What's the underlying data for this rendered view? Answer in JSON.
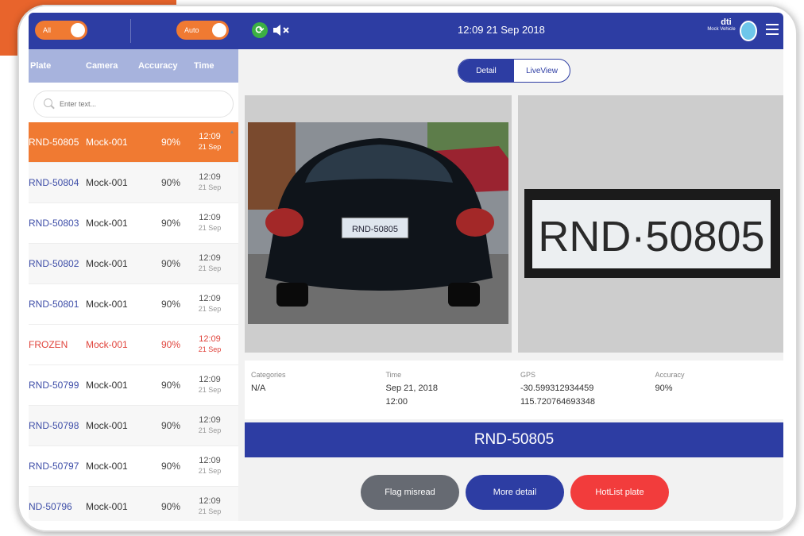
{
  "topbar": {
    "toggle_left_label": "All",
    "toggle_right_label": "Auto",
    "datetime": "12:09 21 Sep 2018",
    "user_short": "dti",
    "user_full": "Mock Vehicle",
    "refresh_icon": "refresh-icon",
    "mute_icon": "mute-icon",
    "menu_icon": "hamburger-menu-icon",
    "brand_color": "#2d3da3",
    "accent_color": "#f07a32"
  },
  "sidebar": {
    "columns": {
      "plate": "Plate",
      "camera": "Camera",
      "accuracy": "Accuracy",
      "time": "Time"
    },
    "search": {
      "placeholder": "Enter text..."
    },
    "rows": [
      {
        "plate": "RND-50805",
        "camera": "Mock-001",
        "accuracy": "90%",
        "time": "12:09",
        "date": "21 Sep",
        "state": "selected"
      },
      {
        "plate": "RND-50804",
        "camera": "Mock-001",
        "accuracy": "90%",
        "time": "12:09",
        "date": "21 Sep",
        "state": "normal"
      },
      {
        "plate": "RND-50803",
        "camera": "Mock-001",
        "accuracy": "90%",
        "time": "12:09",
        "date": "21 Sep",
        "state": "normal"
      },
      {
        "plate": "RND-50802",
        "camera": "Mock-001",
        "accuracy": "90%",
        "time": "12:09",
        "date": "21 Sep",
        "state": "normal"
      },
      {
        "plate": "RND-50801",
        "camera": "Mock-001",
        "accuracy": "90%",
        "time": "12:09",
        "date": "21 Sep",
        "state": "normal"
      },
      {
        "plate": "FROZEN",
        "camera": "Mock-001",
        "accuracy": "90%",
        "time": "12:09",
        "date": "21 Sep",
        "state": "frozen"
      },
      {
        "plate": "RND-50799",
        "camera": "Mock-001",
        "accuracy": "90%",
        "time": "12:09",
        "date": "21 Sep",
        "state": "normal"
      },
      {
        "plate": "RND-50798",
        "camera": "Mock-001",
        "accuracy": "90%",
        "time": "12:09",
        "date": "21 Sep",
        "state": "normal"
      },
      {
        "plate": "RND-50797",
        "camera": "Mock-001",
        "accuracy": "90%",
        "time": "12:09",
        "date": "21 Sep",
        "state": "normal"
      },
      {
        "plate": "ND-50796",
        "camera": "Mock-001",
        "accuracy": "90%",
        "time": "12:09",
        "date": "21 Sep",
        "state": "normal"
      }
    ]
  },
  "main": {
    "tabs": [
      {
        "label": "Detail",
        "active": true
      },
      {
        "label": "LiveView",
        "active": false
      }
    ],
    "car_plate_text": "RND-50805",
    "crop_plate_text": "RND·50805",
    "info": {
      "categories_label": "Categories",
      "categories_value": "N/A",
      "time_label": "Time",
      "time_value_date": "Sep 21, 2018",
      "time_value_time": "12:00",
      "gps_label": "GPS",
      "gps_lat": "-30.599312934459",
      "gps_lon": "115.720764693348",
      "accuracy_label": "Accuracy",
      "accuracy_value": "90%"
    },
    "banner_plate": "RND-50805",
    "buttons": {
      "flag": "Flag misread",
      "more": "More detail",
      "hotlist": "HotList plate"
    }
  }
}
